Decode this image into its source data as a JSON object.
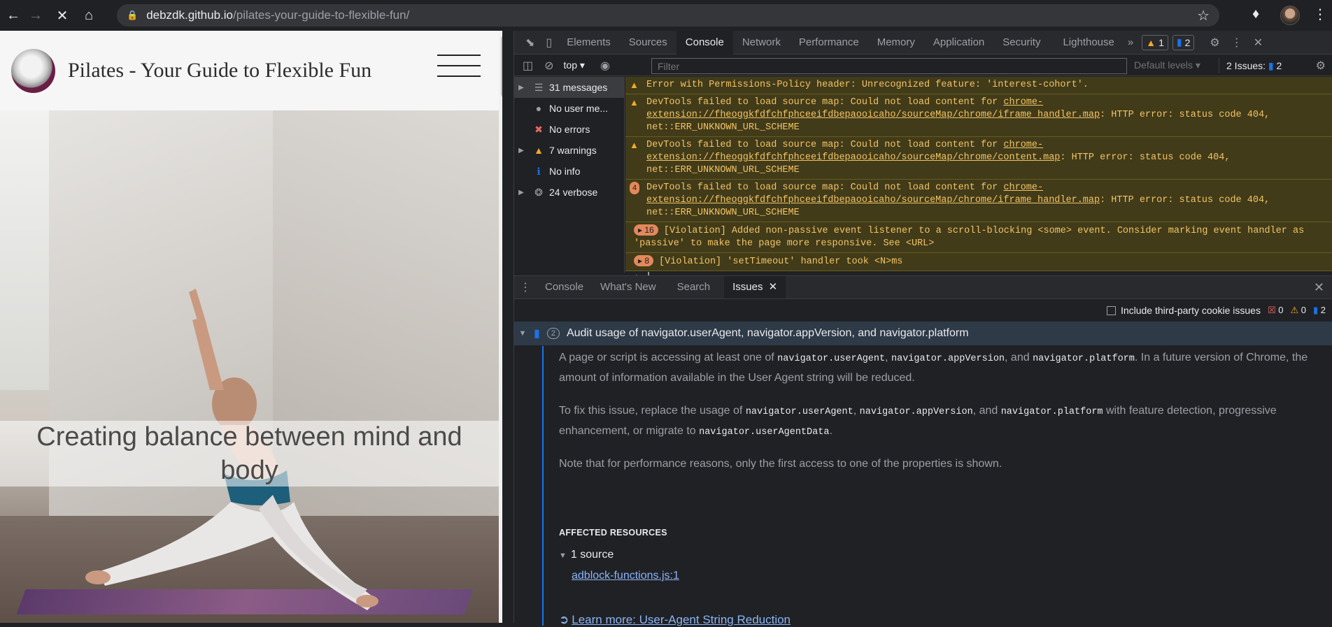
{
  "browser": {
    "url_host": "debzdk.github.io",
    "url_path": "/pilates-your-guide-to-flexible-fun/"
  },
  "site": {
    "title": "Pilates - Your Guide to Flexible Fun",
    "hero_text": "Creating balance between mind and body"
  },
  "devtools": {
    "tabs": [
      "Elements",
      "Sources",
      "Console",
      "Network",
      "Performance",
      "Memory",
      "Application",
      "Security",
      "Lighthouse"
    ],
    "more": "»",
    "warn_badge": "1",
    "issue_badge": "2",
    "context": "top",
    "filter_placeholder": "Filter",
    "default_levels": "Default levels",
    "issues_button": "2 Issues:",
    "issues_count": "2",
    "sidebar": [
      {
        "icon": "list-icon",
        "label": "31 messages"
      },
      {
        "icon": "user-icon",
        "label": "No user me..."
      },
      {
        "icon": "error-icon",
        "label": "No errors"
      },
      {
        "icon": "warning-icon",
        "label": "7 warnings"
      },
      {
        "icon": "info-icon",
        "label": "No info"
      },
      {
        "icon": "bug-icon",
        "label": "24 verbose"
      }
    ],
    "messages": {
      "m1": "Error with Permissions-Policy header: Unrecognized feature: 'interest-cohort'.",
      "m2_pre": "DevTools failed to load source map: Could not load content for ",
      "m2_link": "chrome-extension://fheoggkfdfchfphceeifdbepaooicaho/sourceMap/chrome/iframe_handler.map",
      "m2_post": ": HTTP error: status code 404, net::ERR_UNKNOWN_URL_SCHEME",
      "m3_pre": "DevTools failed to load source map: Could not load content for ",
      "m3_link": "chrome-extension://fheoggkfdfchfphceeifdbepaooicaho/sourceMap/chrome/content.map",
      "m3_post": ": HTTP error: status code 404, net::ERR_UNKNOWN_URL_SCHEME",
      "m4_count": "4",
      "m4_pre": "DevTools failed to load source map: Could not load content for ",
      "m4_link": "chrome-extension://fheoggkfdfchfphceeifdbepaooicaho/sourceMap/chrome/iframe_handler.map",
      "m4_post": ": HTTP error: status code 404, net::ERR_UNKNOWN_URL_SCHEME",
      "m5_count": "16",
      "m5": "[Violation] Added non-passive event listener to a scroll-blocking <some> event. Consider marking event handler as 'passive' to make the page more responsive. See <URL>",
      "m6_count": "8",
      "m6": "[Violation] 'setTimeout' handler took <N>ms"
    },
    "drawer_tabs": [
      "Console",
      "What's New",
      "Search",
      "Issues"
    ],
    "third_party": "Include third-party cookie issues",
    "err_count": "0",
    "warn_count": "0",
    "info_count": "2",
    "issue": {
      "count": "2",
      "title": "Audit usage of navigator.userAgent, navigator.appVersion, and navigator.platform",
      "p1a": "A page or script is accessing at least one of ",
      "c1": "navigator.userAgent",
      "p1b": ", ",
      "c2": "navigator.appVersion",
      "p1c": ", and ",
      "c3": "navigator.platform",
      "p1d": ". In a future version of Chrome, the amount of information available in the User Agent string will be reduced.",
      "p2a": "To fix this issue, replace the usage of ",
      "p2b": " with feature detection, progressive enhancement, or migrate to ",
      "c4": "navigator.userAgentData",
      "p3": "Note that for performance reasons, only the first access to one of the properties is shown.",
      "affected": "AFFECTED RESOURCES",
      "sources": "1 source",
      "source_link": "adblock-functions.js:1",
      "learn_more": "Learn more: User-Agent String Reduction"
    }
  }
}
